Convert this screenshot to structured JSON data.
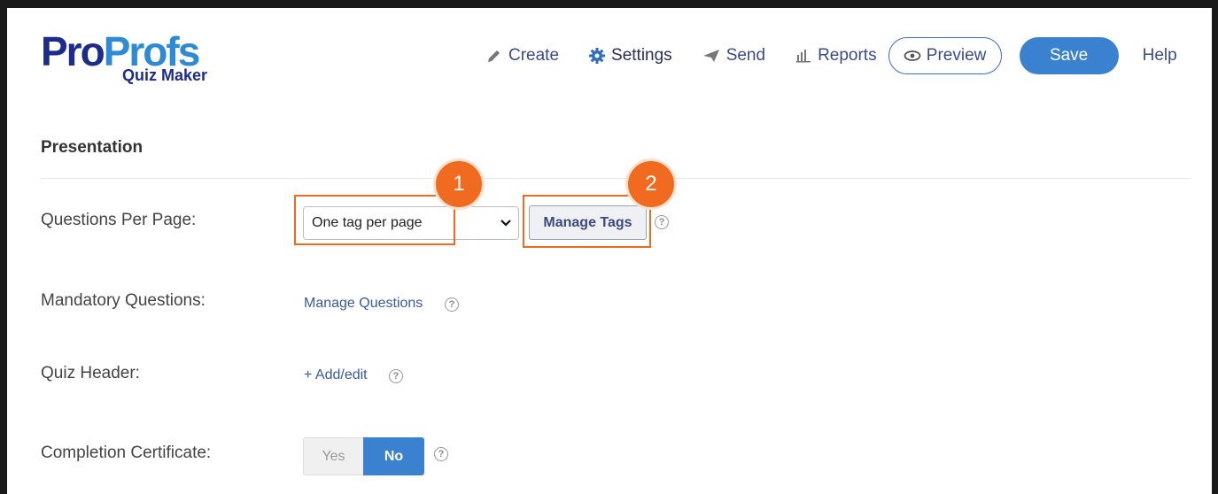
{
  "brand": {
    "pro": "Pro",
    "profs": "Profs",
    "sub": "Quiz Maker"
  },
  "nav": {
    "create": "Create",
    "settings": "Settings",
    "send": "Send",
    "reports": "Reports",
    "preview": "Preview",
    "save": "Save",
    "help": "Help"
  },
  "section": {
    "title": "Presentation"
  },
  "rows": {
    "questions_per_page": {
      "label": "Questions Per Page:",
      "selected": "One tag per page",
      "manage_button": "Manage Tags"
    },
    "mandatory_questions": {
      "label": "Mandatory Questions:",
      "link": "Manage Questions"
    },
    "quiz_header": {
      "label": "Quiz Header:",
      "link": "+ Add/edit"
    },
    "completion_certificate": {
      "label": "Completion Certificate:",
      "yes": "Yes",
      "no": "No",
      "selected": "No"
    }
  },
  "annotations": {
    "badge1": "1",
    "badge2": "2"
  },
  "help_glyph": "?",
  "colors": {
    "accent_blue": "#3a82cf",
    "brand_navy": "#1d2b8a",
    "brand_light": "#2f8ad6",
    "highlight_orange": "#f06a1f"
  },
  "icons": [
    "pencil-icon",
    "gear-icon",
    "paper-plane-icon",
    "bar-chart-icon",
    "eye-icon",
    "chevron-down-icon",
    "help-circle-icon"
  ]
}
